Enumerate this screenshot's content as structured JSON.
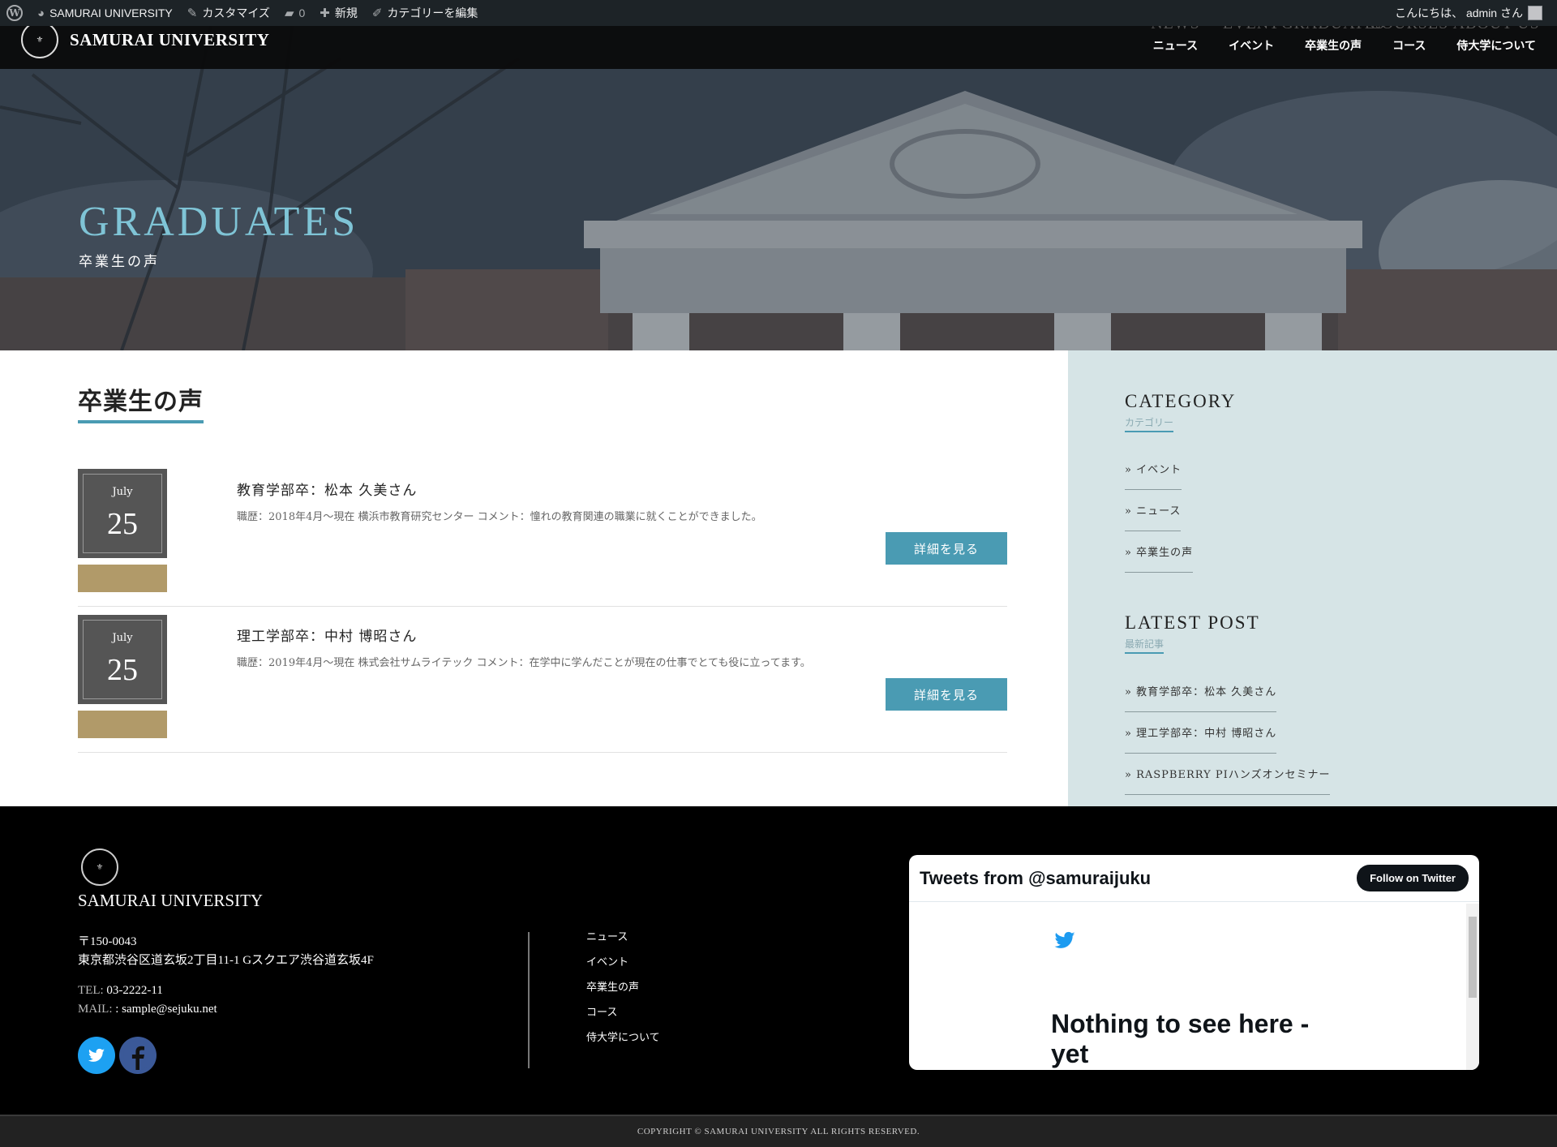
{
  "admin_bar": {
    "site": "SAMURAI UNIVERSITY",
    "customize": "カスタマイズ",
    "comments_count": "0",
    "new": "新規",
    "edit_category": "カテゴリーを編集",
    "greeting": "こんにちは、 admin さん"
  },
  "header": {
    "site_name": "SAMURAI UNIVERSITY",
    "nav": [
      {
        "en": "NEWS",
        "ja": "ニュース"
      },
      {
        "en": "EVENT",
        "ja": "イベント"
      },
      {
        "en": "GRADUATES",
        "ja": "卒業生の声"
      },
      {
        "en": "COURSES",
        "ja": "コース"
      },
      {
        "en": "ABOUT US",
        "ja": "侍大学について"
      }
    ]
  },
  "hero": {
    "title": "GRADUATES",
    "subtitle": "卒業生の声"
  },
  "main": {
    "heading": "卒業生の声",
    "posts": [
      {
        "month": "July",
        "day": "25",
        "title": "教育学部卒：松本 久美さん",
        "body": "職歴：2018年4月～現在 横浜市教育研究センター コメント：憧れの教育関連の職業に就くことができました。",
        "button": "詳細を見る"
      },
      {
        "month": "July",
        "day": "25",
        "title": "理工学部卒：中村 博昭さん",
        "body": "職歴：2019年4月～現在 株式会社サムライテック コメント：在学中に学んだことが現在の仕事でとても役に立ってます。",
        "button": "詳細を見る"
      }
    ]
  },
  "sidebar": {
    "category": {
      "title": "CATEGORY",
      "subtitle": "カテゴリー",
      "links": [
        "» イベント",
        "» ニュース",
        "» 卒業生の声"
      ]
    },
    "latest": {
      "title": "LATEST POST",
      "subtitle": "最新記事",
      "links": [
        "» 教育学部卒：松本 久美さん",
        "» 理工学部卒：中村 博昭さん",
        "» RASPBERRY PIハンズオンセミナー"
      ]
    }
  },
  "footer": {
    "site_name": "SAMURAI UNIVERSITY",
    "postal": "〒150-0043",
    "address": "東京都渋谷区道玄坂2丁目11-1 Gスクエア渋谷道玄坂4F",
    "tel_label": "TEL:",
    "tel": "03-2222-11",
    "mail_label": "MAIL:",
    "mail": ": sample@sejuku.net",
    "nav": [
      "ニュース",
      "イベント",
      "卒業生の声",
      "コース",
      "侍大学について"
    ],
    "twitter_widget": {
      "title": "Tweets from @samuraijuku",
      "follow": "Follow on Twitter",
      "empty": "Nothing to see here - yet"
    },
    "copyright": "COPYRIGHT © SAMURAI UNIVERSITY ALL RIGHTS RESERVED."
  },
  "colors": {
    "accent": "#4a9bb3",
    "hero_title": "#7fc4d6",
    "date_strip": "#b19a69",
    "sidebar_bg": "#d6e4e6",
    "twitter_blue": "#1da1f2",
    "facebook_blue": "#3b5998"
  },
  "icons": {
    "wordpress": "wordpress-icon",
    "customize": "brush-icon",
    "comments": "comment-icon",
    "new": "plus-icon",
    "edit": "pencil-icon",
    "twitter": "twitter-icon",
    "facebook": "facebook-icon"
  }
}
